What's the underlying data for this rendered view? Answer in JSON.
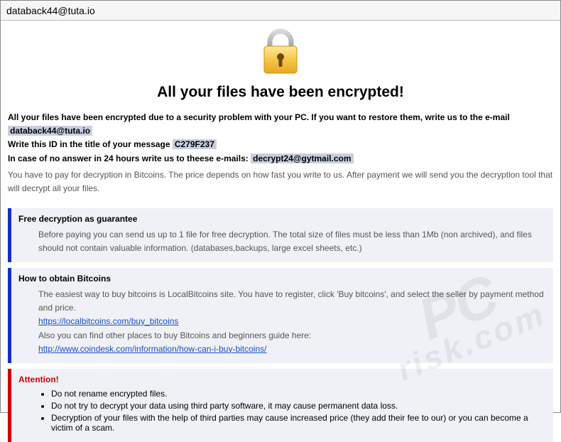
{
  "window": {
    "title": "databack44@tuta.io"
  },
  "header": {
    "main_title": "All your files have been encrypted!"
  },
  "intro": {
    "line1_prefix": "All your files have been encrypted due to a security problem with your PC. If you want to restore them, write us to the e-mail ",
    "email1": "databack44@tuta.io",
    "line2_prefix": "Write this ID in the title of your message ",
    "id_value": "C279F237",
    "line3_prefix": "In case of no answer in 24 hours write us to theese e-mails: ",
    "email2": "decrypt24@gytmail.com",
    "pay_note": "You have to pay for decryption in Bitcoins. The price depends on how fast you write to us. After payment we will send you the decryption tool that will decrypt all your files."
  },
  "panel_free": {
    "title": "Free decryption as guarantee",
    "body": "Before paying you can send us up to 1 file for free decryption. The total size of files must be less than 1Mb (non archived), and files should not contain valuable information. (databases,backups, large excel sheets, etc.)"
  },
  "panel_btc": {
    "title": "How to obtain Bitcoins",
    "line1": "The easiest way to buy bitcoins is LocalBitcoins site. You have to register, click 'Buy bitcoins', and select the seller by payment method and price.",
    "link1": "https://localbitcoins.com/buy_bitcoins",
    "line2": "Also you can find other places to buy Bitcoins and beginners guide here:",
    "link2": "http://www.coindesk.com/information/how-can-i-buy-bitcoins/"
  },
  "panel_attn": {
    "title": "Attention!",
    "items": [
      "Do not rename encrypted files.",
      "Do not try to decrypt your data using third party software, it may cause permanent data loss.",
      "Decryption of your files with the help of third parties may cause increased price (they add their fee to our) or you can become a victim of a scam."
    ]
  },
  "watermark": {
    "line1": "PC",
    "line2": "risk.com"
  }
}
